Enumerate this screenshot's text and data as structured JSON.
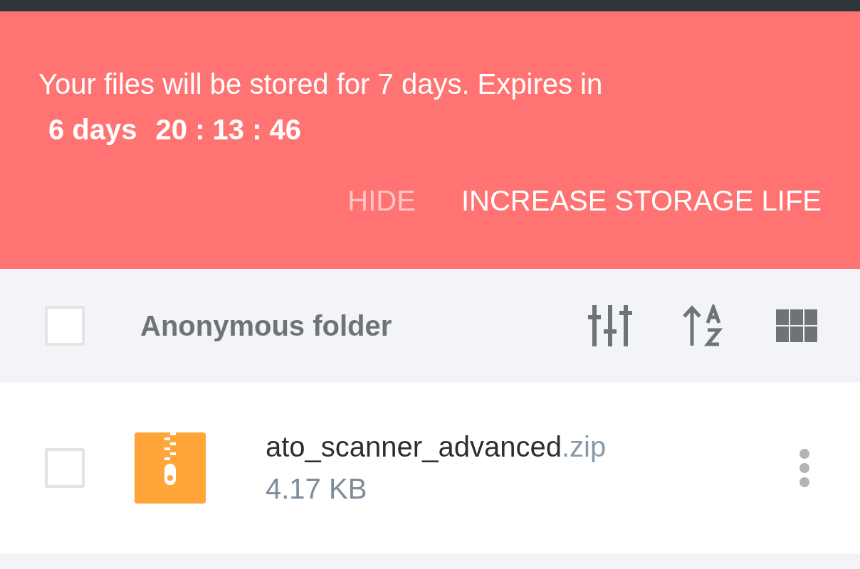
{
  "banner": {
    "message": "Your files will be stored for 7 days. Expires in",
    "countdown_days": "6 days",
    "countdown_time": "20 : 13 : 46",
    "buttons": [
      {
        "label": "HIDE",
        "kind": "secondary"
      },
      {
        "label": "INCREASE STORAGE LIFE",
        "kind": "primary"
      }
    ]
  },
  "folder_header": {
    "checked": false,
    "title": "Anonymous folder"
  },
  "files": [
    {
      "checked": false,
      "name": "ato_scanner_advanced",
      "extension": ".zip",
      "size": "4.17 KB"
    }
  ]
}
